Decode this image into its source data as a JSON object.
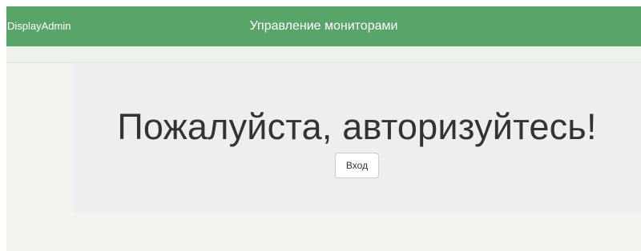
{
  "navbar": {
    "brand": "DisplayAdmin",
    "title": "Управление мониторами"
  },
  "main": {
    "heading": "Пожалуйста, авторизуйтесь!",
    "login_button": "Вход"
  },
  "colors": {
    "navbar": "#59a468",
    "page_background": "#f2f5ef",
    "jumbotron": "#eeeeee"
  }
}
